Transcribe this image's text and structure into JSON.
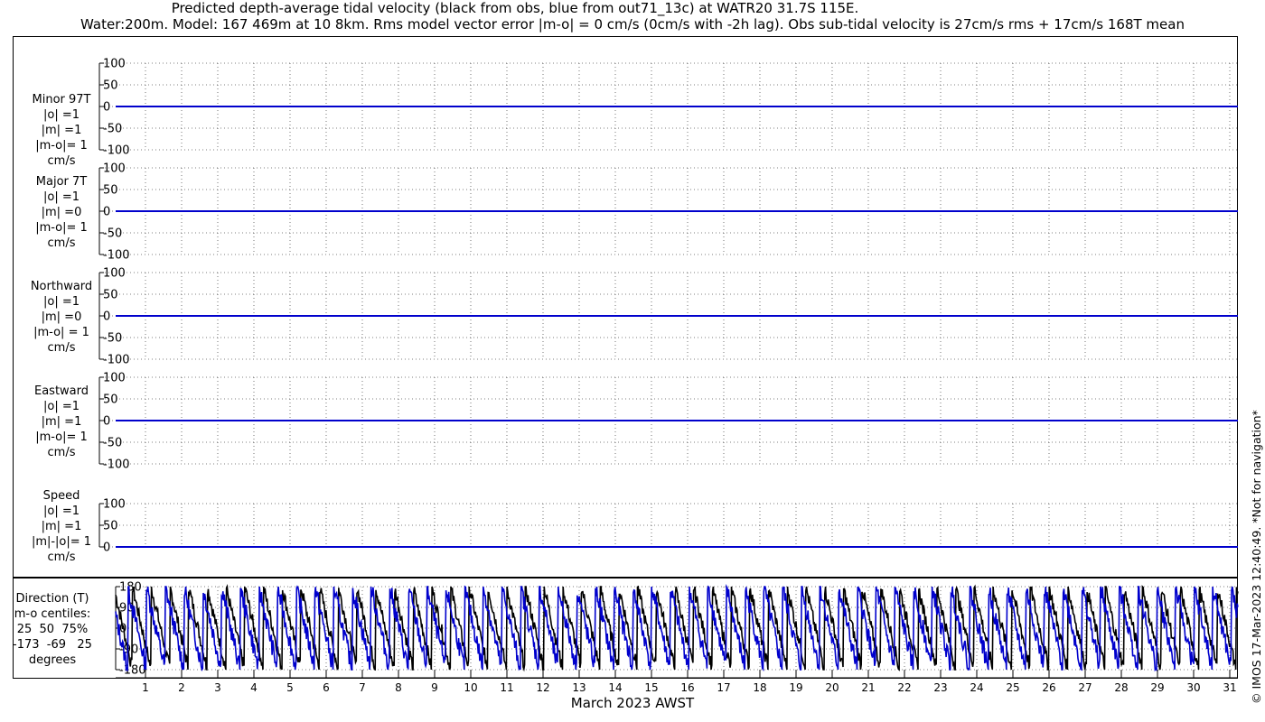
{
  "title_line1": "Predicted depth-average tidal velocity (black from obs, blue from out71_13c) at WATR20 31.7S 115E.",
  "title_line2": "Water:200m. Model: 167 469m at 10 8km. Rms model vector error |m-o| = 0 cm/s (0cm/s with -2h lag). Obs sub-tidal velocity is 27cm/s rms + 17cm/s 168T mean",
  "xlabel": "March 2023 AWST",
  "copyright": "© IMOS 17-Mar-2023 12:40:49. *Not for navigation*",
  "colors": {
    "obs": "#000000",
    "model": "#0000cc",
    "grid": "#555555"
  },
  "chart_data": [
    {
      "type": "line",
      "panel": "minor",
      "label_lines": [
        "Minor 97T",
        "|o| =1",
        "|m| =1",
        "|m-o|= 1",
        "cm/s"
      ],
      "ylim": [
        -100,
        100
      ],
      "yticks": [
        100,
        50,
        0,
        -50,
        -100
      ],
      "obs_value": 0,
      "model_value": 0
    },
    {
      "type": "line",
      "panel": "major",
      "label_lines": [
        "Major 7T",
        "|o| =1",
        "|m| =0",
        "|m-o|= 1",
        "cm/s"
      ],
      "ylim": [
        -100,
        100
      ],
      "yticks": [
        100,
        50,
        0,
        -50,
        -100
      ],
      "obs_value": 0,
      "model_value": 0
    },
    {
      "type": "line",
      "panel": "north",
      "label_lines": [
        "Northward",
        "|o| =1",
        "|m| =0",
        "|m-o| = 1",
        "cm/s"
      ],
      "ylim": [
        -100,
        100
      ],
      "yticks": [
        100,
        50,
        0,
        -50,
        -100
      ],
      "obs_value": 0,
      "model_value": 0
    },
    {
      "type": "line",
      "panel": "east",
      "label_lines": [
        "Eastward",
        "|o| =1",
        "|m| =1",
        "|m-o|= 1",
        "cm/s"
      ],
      "ylim": [
        -100,
        100
      ],
      "yticks": [
        100,
        50,
        0,
        -50,
        -100
      ],
      "obs_value": 0,
      "model_value": 0
    },
    {
      "type": "line",
      "panel": "speed",
      "label_lines": [
        "Speed",
        "|o| =1",
        "|m| =1",
        "|m|-|o|= 1",
        "cm/s"
      ],
      "ylim": [
        0,
        100
      ],
      "yticks": [
        100,
        50,
        0
      ],
      "obs_value": 0,
      "model_value": 0
    },
    {
      "type": "line",
      "panel": "direction",
      "label_lines": [
        "Direction (T)",
        "m-o centiles:",
        "25  50  75%",
        "-173  -69   25",
        "degrees"
      ],
      "ylim": [
        -180,
        180
      ],
      "yticks": [
        180,
        90,
        0,
        -90,
        -180
      ],
      "x_days": [
        1,
        31
      ],
      "x_ticks": [
        1,
        2,
        3,
        4,
        5,
        6,
        7,
        8,
        9,
        10,
        11,
        12,
        13,
        14,
        15,
        16,
        17,
        18,
        19,
        20,
        21,
        22,
        23,
        24,
        25,
        26,
        27,
        28,
        29,
        30,
        31
      ],
      "obs_period_hours": 24.8,
      "model_period_hours": 24.8,
      "note": "sawtooth wrapped direction series"
    }
  ]
}
